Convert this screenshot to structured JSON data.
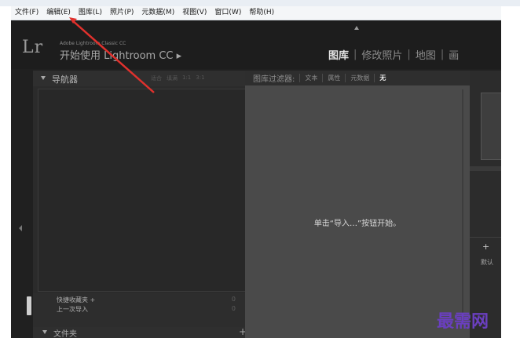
{
  "menubar": {
    "items": [
      {
        "label": "文件(F)"
      },
      {
        "label": "编辑(E)"
      },
      {
        "label": "图库(L)"
      },
      {
        "label": "照片(P)"
      },
      {
        "label": "元数据(M)"
      },
      {
        "label": "视图(V)"
      },
      {
        "label": "窗口(W)"
      },
      {
        "label": "帮助(H)"
      }
    ]
  },
  "identity": {
    "logo": "Lr",
    "adobe_line": "Adobe Lightroom Classic CC",
    "getting_started": "开始使用 Lightroom CC ▸"
  },
  "modules": [
    {
      "label": "图库",
      "active": true
    },
    {
      "label": "修改照片",
      "active": false
    },
    {
      "label": "地图",
      "active": false
    },
    {
      "label": "画",
      "active": false
    }
  ],
  "navigator": {
    "title": "导航器",
    "zoom_options": [
      "适合",
      "填满",
      "1:1",
      "3:1"
    ]
  },
  "collections": {
    "quick": {
      "label": "快捷收藏夹 +",
      "count": "0"
    },
    "previous": {
      "label": "上一次导入",
      "count": "0"
    }
  },
  "folders": {
    "label": "文件夹",
    "add": "+"
  },
  "filter": {
    "title": "图库过滤器:",
    "tabs": [
      {
        "label": "文本",
        "on": false
      },
      {
        "label": "属性",
        "on": false
      },
      {
        "label": "元数据",
        "on": false
      },
      {
        "label": "无",
        "on": true
      }
    ]
  },
  "center": {
    "message": "单击“导入…”按钮开始。"
  },
  "right_panel": {
    "plus": "+",
    "default_label": "默认"
  },
  "watermark": "最需网",
  "colors": {
    "annotation_arrow": "#e0312d",
    "watermark": "#6a3fbf"
  }
}
